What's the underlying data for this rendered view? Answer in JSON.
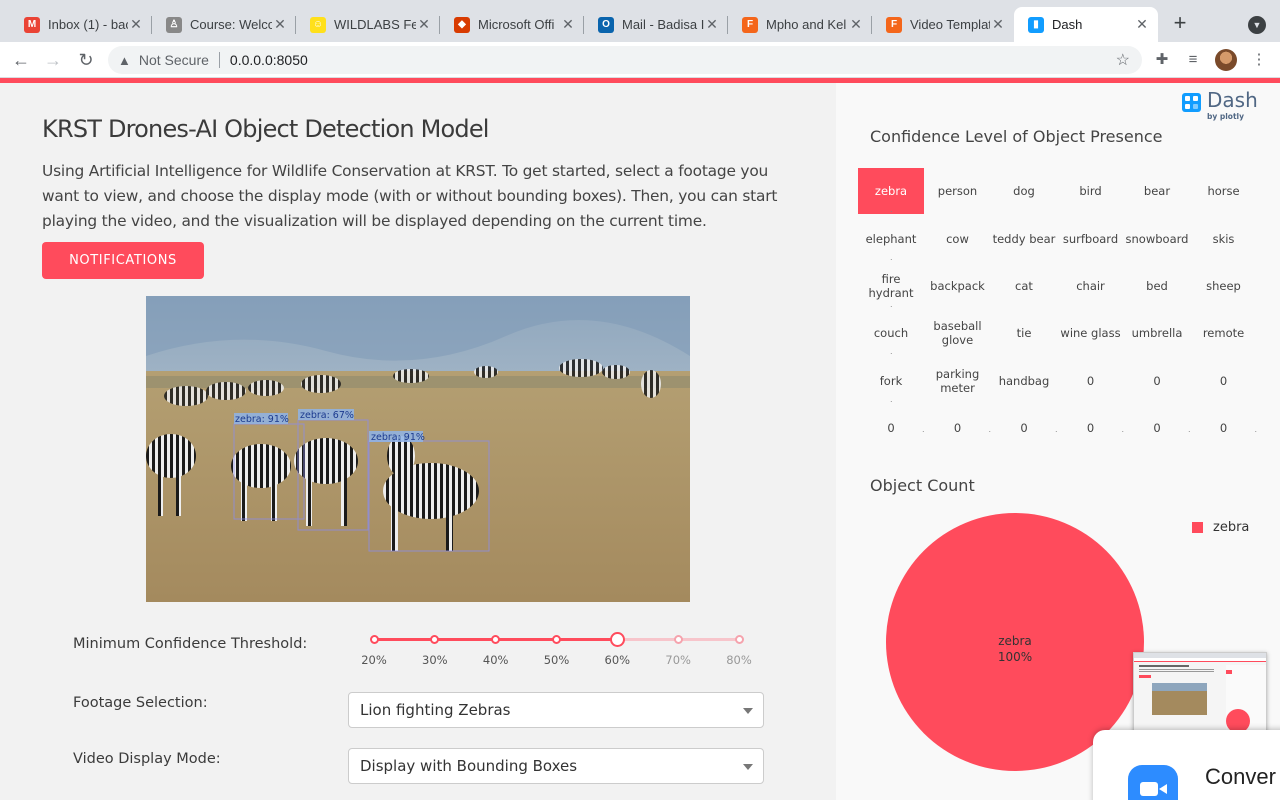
{
  "browser": {
    "tabs": [
      {
        "title": "Inbox (1) - bac",
        "icon": "gmail-icon",
        "color": "#ea4335",
        "glyph": "M"
      },
      {
        "title": "Course: Welco",
        "icon": "course-icon",
        "color": "#888888",
        "glyph": "♙"
      },
      {
        "title": "WILDLABS Fe",
        "icon": "mailchimp-icon",
        "color": "#ffe01b",
        "glyph": "☺"
      },
      {
        "title": "Microsoft Offi",
        "icon": "office-icon",
        "color": "#d83b01",
        "glyph": "◆"
      },
      {
        "title": "Mail - Badisa I",
        "icon": "outlook-icon",
        "color": "#0a64ad",
        "glyph": "O"
      },
      {
        "title": "Mpho and Kel",
        "icon": "formstack-icon",
        "color": "#f4661b",
        "glyph": "F"
      },
      {
        "title": "Video Templat",
        "icon": "formstack-icon",
        "color": "#f4661b",
        "glyph": "F"
      },
      {
        "title": "Dash",
        "icon": "dash-tab-icon",
        "color": "#119dff",
        "glyph": "▮",
        "active": true
      }
    ],
    "security_label": "Not Secure",
    "url": "0.0.0.0:8050"
  },
  "app": {
    "title": "KRST Drones-AI Object Detection Model",
    "description": "Using Artificial Intelligence for Wildlife Conservation at KRST. To get started, select a footage you want to view, and choose the display mode (with or without bounding boxes). Then, you can start playing the video, and the visualization will be displayed depending on the current time.",
    "notifications_label": "NOTIFICATIONS",
    "video": {
      "detections": [
        "zebra: 91%",
        "zebra: 67%",
        "zebra: 91%"
      ]
    },
    "threshold": {
      "label": "Minimum Confidence Threshold:",
      "marks": [
        "20%",
        "30%",
        "40%",
        "50%",
        "60%",
        "70%",
        "80%"
      ],
      "value": 60
    },
    "footage": {
      "label": "Footage Selection:",
      "selected": "Lion fighting Zebras"
    },
    "display_mode": {
      "label": "Video Display Mode:",
      "selected": "Display with Bounding Boxes"
    }
  },
  "right": {
    "brand": {
      "word": "Dash",
      "by": "by plotly"
    },
    "confidence_title": "Confidence Level of Object Presence",
    "objects": [
      [
        "zebra",
        "person",
        "dog",
        "bird",
        "bear",
        "horse"
      ],
      [
        "elephant",
        "cow",
        "teddy bear",
        "surfboard",
        "snowboard",
        "skis"
      ],
      [
        "fire hydrant",
        "backpack",
        "cat",
        "chair",
        "bed",
        "sheep"
      ],
      [
        "couch",
        "baseball glove",
        "tie",
        "wine glass",
        "umbrella",
        "remote"
      ],
      [
        "fork",
        "parking meter",
        "handbag",
        "0",
        "0",
        "0"
      ],
      [
        "0",
        "0",
        "0",
        "0",
        "0",
        "0"
      ]
    ],
    "highlighted_object": "zebra",
    "count_title": "Object Count",
    "overlay_text": "Conver",
    "accent_color": "#ff4b5c"
  },
  "chart_data": {
    "type": "pie",
    "title": "Object Count",
    "categories": [
      "zebra"
    ],
    "values": [
      100
    ],
    "labels": [
      "zebra\n100%"
    ],
    "legend": [
      "zebra"
    ],
    "legend_position": "top-right",
    "colors": [
      "#ff4b5c"
    ]
  }
}
